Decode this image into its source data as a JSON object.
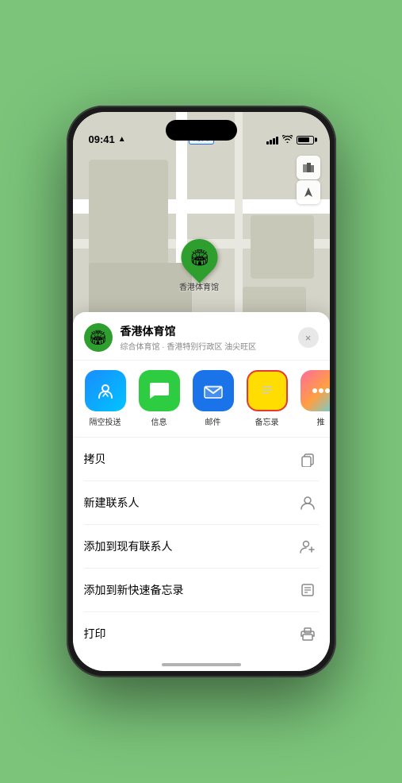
{
  "status_bar": {
    "time": "09:41",
    "location_arrow": "▲"
  },
  "map": {
    "label_text": "南口",
    "stadium_name": "香港体育馆",
    "controls": {
      "map_icon": "🗺",
      "location_icon": "➤"
    }
  },
  "sheet": {
    "venue_name": "香港体育馆",
    "venue_sub": "综合体育馆 · 香港特别行政区 油尖旺区",
    "close_label": "×"
  },
  "share_items": [
    {
      "label": "隔空投送",
      "type": "airdrop"
    },
    {
      "label": "信息",
      "type": "message"
    },
    {
      "label": "邮件",
      "type": "mail"
    },
    {
      "label": "备忘录",
      "type": "notes"
    },
    {
      "label": "推",
      "type": "more"
    }
  ],
  "actions": [
    {
      "label": "拷贝",
      "icon": "copy"
    },
    {
      "label": "新建联系人",
      "icon": "person"
    },
    {
      "label": "添加到现有联系人",
      "icon": "person-add"
    },
    {
      "label": "添加到新快速备忘录",
      "icon": "note"
    },
    {
      "label": "打印",
      "icon": "print"
    }
  ]
}
